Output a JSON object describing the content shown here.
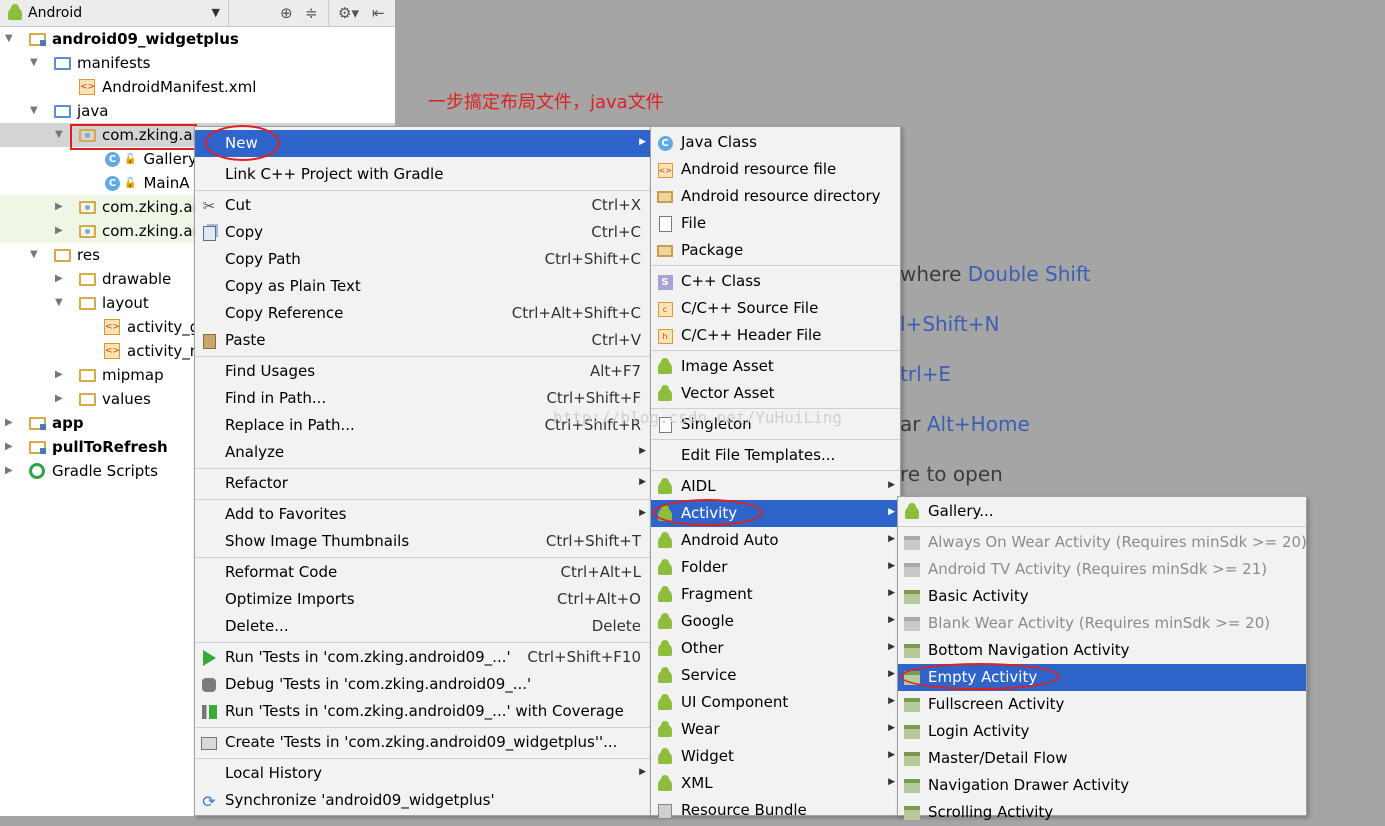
{
  "panel": {
    "view_mode": "Android",
    "tree": [
      {
        "label": "android09_widgetplus",
        "bold": true
      },
      {
        "label": "manifests"
      },
      {
        "label": "AndroidManifest.xml"
      },
      {
        "label": "java"
      },
      {
        "label": "com.zking.ar"
      },
      {
        "label": "Gallery"
      },
      {
        "label": "MainA"
      },
      {
        "label": "com.zking.ar"
      },
      {
        "label": "com.zking.ar"
      },
      {
        "label": "res"
      },
      {
        "label": "drawable"
      },
      {
        "label": "layout"
      },
      {
        "label": "activity_g"
      },
      {
        "label": "activity_m"
      },
      {
        "label": "mipmap"
      },
      {
        "label": "values"
      },
      {
        "label": "app",
        "bold": true
      },
      {
        "label": "pullToRefresh",
        "bold": true
      },
      {
        "label": "Gradle Scripts"
      }
    ]
  },
  "annotation": "一步搞定布局文件，java文件",
  "watermark": "http://blog.csdn.net/YuHuiLing",
  "hints": [
    {
      "prefix": "where ",
      "key": "Double Shift"
    },
    {
      "prefix": "",
      "key": "l+Shift+N"
    },
    {
      "prefix": "",
      "key": "trl+E"
    },
    {
      "prefix": "ar ",
      "key": "Alt+Home"
    },
    {
      "prefix": "re to open",
      "key": ""
    }
  ],
  "context_menu": [
    {
      "label": "New",
      "submenu": true,
      "highlighted": true
    },
    {
      "label": "Link C++ Project with Gradle"
    },
    {
      "label": "Cut",
      "shortcut": "Ctrl+X",
      "icon": "scissors-icon"
    },
    {
      "label": "Copy",
      "shortcut": "Ctrl+C",
      "icon": "copy-icon"
    },
    {
      "label": "Copy Path",
      "shortcut": "Ctrl+Shift+C"
    },
    {
      "label": "Copy as Plain Text"
    },
    {
      "label": "Copy Reference",
      "shortcut": "Ctrl+Alt+Shift+C"
    },
    {
      "label": "Paste",
      "shortcut": "Ctrl+V",
      "icon": "paste-icon"
    },
    {
      "label": "Find Usages",
      "shortcut": "Alt+F7"
    },
    {
      "label": "Find in Path...",
      "shortcut": "Ctrl+Shift+F"
    },
    {
      "label": "Replace in Path...",
      "shortcut": "Ctrl+Shift+R"
    },
    {
      "label": "Analyze",
      "submenu": true
    },
    {
      "label": "Refactor",
      "submenu": true
    },
    {
      "label": "Add to Favorites",
      "submenu": true
    },
    {
      "label": "Show Image Thumbnails",
      "shortcut": "Ctrl+Shift+T"
    },
    {
      "label": "Reformat Code",
      "shortcut": "Ctrl+Alt+L"
    },
    {
      "label": "Optimize Imports",
      "shortcut": "Ctrl+Alt+O"
    },
    {
      "label": "Delete...",
      "shortcut": "Delete"
    },
    {
      "label": "Run 'Tests in 'com.zking.android09_...'",
      "shortcut": "Ctrl+Shift+F10",
      "icon": "run-icon"
    },
    {
      "label": "Debug 'Tests in 'com.zking.android09_...'",
      "icon": "debug-icon"
    },
    {
      "label": "Run 'Tests in 'com.zking.android09_...' with Coverage",
      "icon": "coverage-icon"
    },
    {
      "label": "Create 'Tests in 'com.zking.android09_widgetplus''...",
      "icon": "create-test-icon"
    },
    {
      "label": "Local History",
      "submenu": true
    },
    {
      "label": "Synchronize 'android09_widgetplus'",
      "icon": "sync-icon"
    }
  ],
  "new_menu": [
    {
      "label": "Java Class",
      "icon": "java-class-icon"
    },
    {
      "label": "Android resource file",
      "icon": "xml-file-icon"
    },
    {
      "label": "Android resource directory",
      "icon": "folder-icon"
    },
    {
      "label": "File",
      "icon": "file-icon"
    },
    {
      "label": "Package",
      "icon": "package-icon"
    },
    {
      "label": "C++ Class",
      "icon": "cpp-class-icon"
    },
    {
      "label": "C/C++ Source File",
      "icon": "cpp-source-icon"
    },
    {
      "label": "C/C++ Header File",
      "icon": "cpp-header-icon"
    },
    {
      "label": "Image Asset",
      "icon": "android-icon"
    },
    {
      "label": "Vector Asset",
      "icon": "android-icon"
    },
    {
      "label": "Singleton",
      "icon": "file-icon"
    },
    {
      "label": "Edit File Templates..."
    },
    {
      "label": "AIDL",
      "submenu": true,
      "icon": "android-icon"
    },
    {
      "label": "Activity",
      "submenu": true,
      "highlighted": true,
      "icon": "android-icon"
    },
    {
      "label": "Android Auto",
      "submenu": true,
      "icon": "android-icon"
    },
    {
      "label": "Folder",
      "submenu": true,
      "icon": "android-icon"
    },
    {
      "label": "Fragment",
      "submenu": true,
      "icon": "android-icon"
    },
    {
      "label": "Google",
      "submenu": true,
      "icon": "android-icon"
    },
    {
      "label": "Other",
      "submenu": true,
      "icon": "android-icon"
    },
    {
      "label": "Service",
      "submenu": true,
      "icon": "android-icon"
    },
    {
      "label": "UI Component",
      "submenu": true,
      "icon": "android-icon"
    },
    {
      "label": "Wear",
      "submenu": true,
      "icon": "android-icon"
    },
    {
      "label": "Widget",
      "submenu": true,
      "icon": "android-icon"
    },
    {
      "label": "XML",
      "submenu": true,
      "icon": "android-icon"
    },
    {
      "label": "Resource Bundle",
      "icon": "resource-bundle-icon"
    }
  ],
  "activity_menu": [
    {
      "label": "Gallery...",
      "icon": "android-icon"
    },
    {
      "label": "Always On Wear Activity (Requires minSdk >= 20)",
      "disabled": true
    },
    {
      "label": "Android TV Activity (Requires minSdk >= 21)",
      "disabled": true
    },
    {
      "label": "Basic Activity"
    },
    {
      "label": "Blank Wear Activity (Requires minSdk >= 20)",
      "disabled": true
    },
    {
      "label": "Bottom Navigation Activity"
    },
    {
      "label": "Empty Activity",
      "highlighted": true
    },
    {
      "label": "Fullscreen Activity"
    },
    {
      "label": "Login Activity"
    },
    {
      "label": "Master/Detail Flow"
    },
    {
      "label": "Navigation Drawer Activity"
    },
    {
      "label": "Scrolling Activity"
    }
  ]
}
